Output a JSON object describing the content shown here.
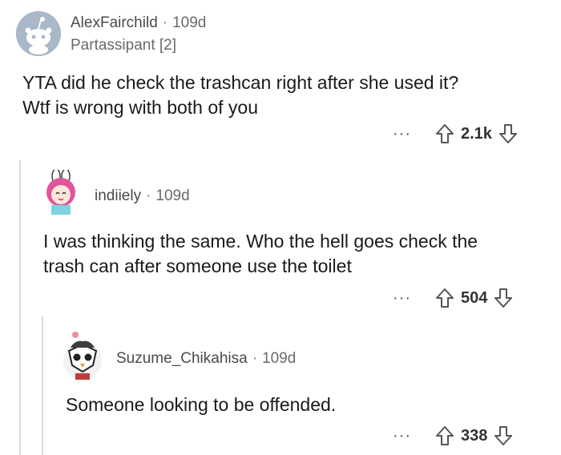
{
  "comments": [
    {
      "username": "AlexFairchild",
      "age": "109d",
      "flair": "Partassipant [2]",
      "avatar_icon": "reddit-snoo-avatar",
      "lines": [
        "YTA did he check the trashcan right after she used it?",
        "Wtf is wrong with both of you"
      ],
      "score": "2.1k"
    },
    {
      "username": "indiiely",
      "age": "109d",
      "avatar_icon": "anime-girl-bunny-ears-avatar",
      "lines": [
        "I was thinking the same. Who the hell goes check the",
        "trash can after someone use the toilet"
      ],
      "score": "504"
    },
    {
      "username": "Suzume_Chikahisa",
      "age": "109d",
      "avatar_icon": "owl-mask-avatar",
      "lines": [
        "Someone looking to be offended."
      ],
      "score": "338"
    }
  ],
  "separator": "·",
  "more_label": "···",
  "colors": {
    "avatar_bg": "#8ea3b8",
    "thread_line": "#dcdcdc",
    "upvote": "#555555"
  }
}
